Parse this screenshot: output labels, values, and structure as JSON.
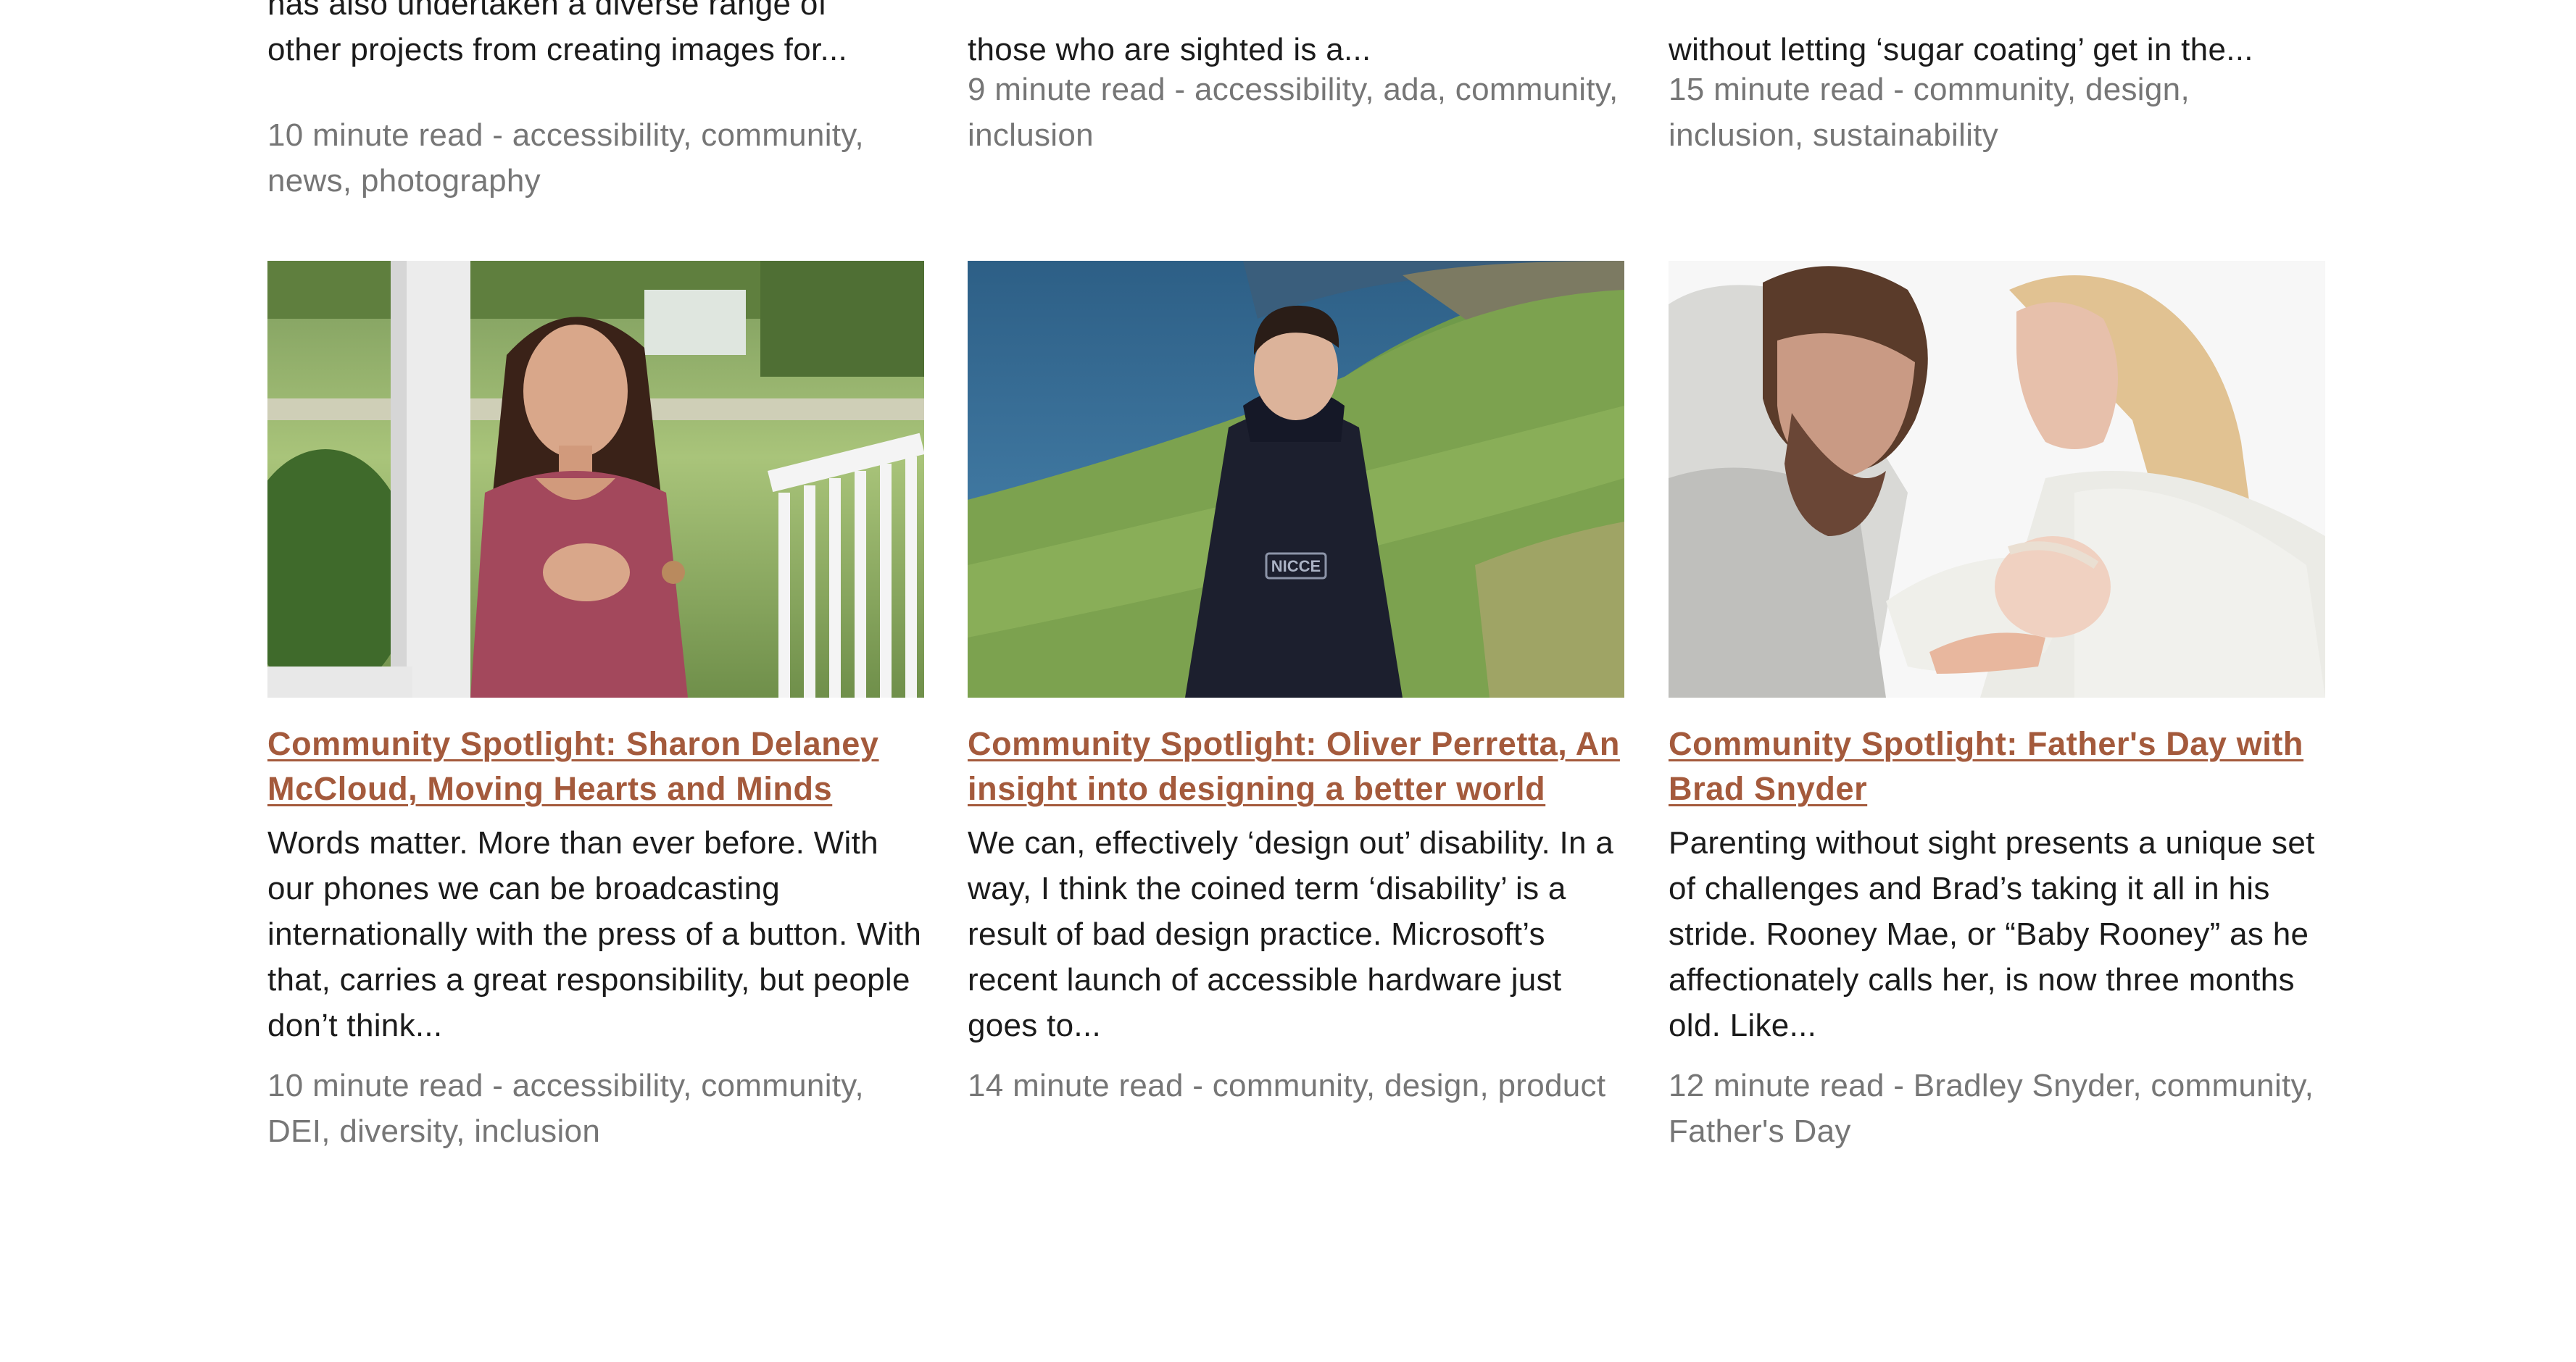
{
  "top_row": [
    {
      "excerpt_lines": [
        "has also undertaken a diverse range of",
        "other projects from creating images for..."
      ],
      "read_time": "10 minute read",
      "tags": [
        "accessibility",
        "community",
        "news",
        "photography"
      ]
    },
    {
      "excerpt_lines": [
        "those who are sighted is a..."
      ],
      "read_time": "9 minute read",
      "tags": [
        "accessibility",
        "ada",
        "community",
        "inclusion"
      ]
    },
    {
      "excerpt_lines": [
        "without letting ‘sugar coating’ get in the..."
      ],
      "read_time": "15 minute read",
      "tags": [
        "community",
        "design",
        "inclusion",
        "sustainability"
      ]
    }
  ],
  "cards": [
    {
      "image": "photo-woman-on-porch",
      "title": "Community Spotlight: Sharon Delaney McCloud, Moving Hearts and Minds",
      "excerpt": "Words matter. More than ever before. With our phones we can be broadcasting internationally with the press of a button. With that, carries a great responsibility, but people don’t think...",
      "read_time": "10 minute read",
      "tags": [
        "accessibility",
        "community",
        "DEI",
        "diversity",
        "inclusion"
      ]
    },
    {
      "image": "photo-man-in-hoodie-coast",
      "title": "Community Spotlight: Oliver Perretta, An insight into designing a better world",
      "excerpt": "We can, effectively ‘design out’ disability. In a way, I think the coined term ‘disability’ is a result of bad design practice. Microsoft’s recent launch of accessible hardware just goes to...",
      "read_time": "14 minute read",
      "tags": [
        "community",
        "design",
        "product"
      ],
      "hoodie_text": "NICCE"
    },
    {
      "image": "photo-parents-with-newborn",
      "title": "Community Spotlight: Father's Day with Brad Snyder",
      "excerpt": "Parenting without sight presents a unique set of challenges and Brad’s taking it all in his stride. Rooney Mae, or “Baby Rooney” as he affectionately calls her, is now three months old. Like...",
      "read_time": "12 minute read",
      "tags": [
        "Bradley Snyder",
        "community",
        "Father's Day"
      ]
    }
  ],
  "meta_separator": " - ",
  "colors": {
    "link": "#a45a3c",
    "meta": "#767676",
    "body_text": "#1b1b1b"
  }
}
